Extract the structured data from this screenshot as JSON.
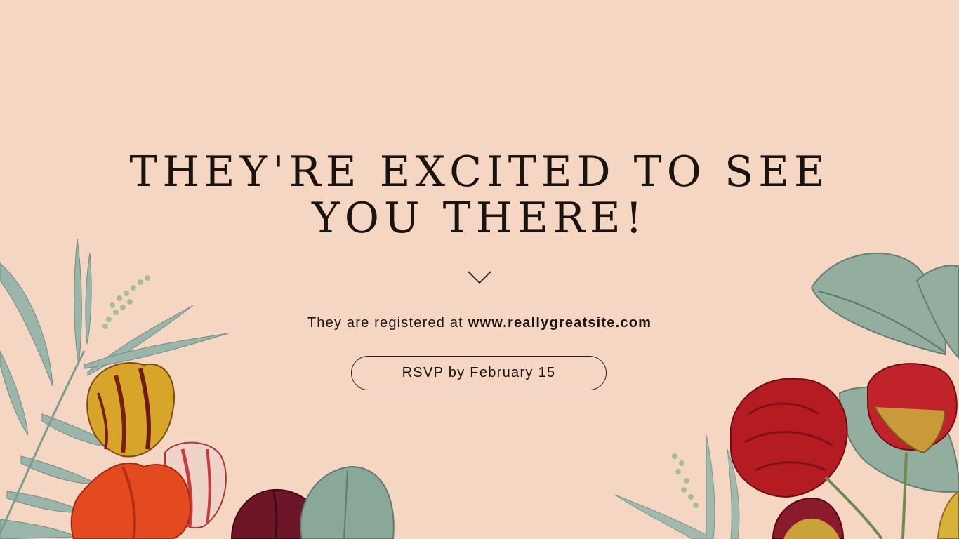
{
  "invite": {
    "heading_line1": "THEY'RE EXCITED TO SEE",
    "heading_line2": "YOU THERE!",
    "registry_prefix": "They are registered at",
    "registry_site": "www.reallygreatsite.com",
    "rsvp_label": "RSVP by February 15"
  },
  "colors": {
    "background": "#f5d6c3",
    "text": "#1a1410",
    "leaf": "#8fa79c",
    "red_flower": "#b01a1f"
  },
  "icons": {
    "divider": "chevron-down-icon"
  }
}
